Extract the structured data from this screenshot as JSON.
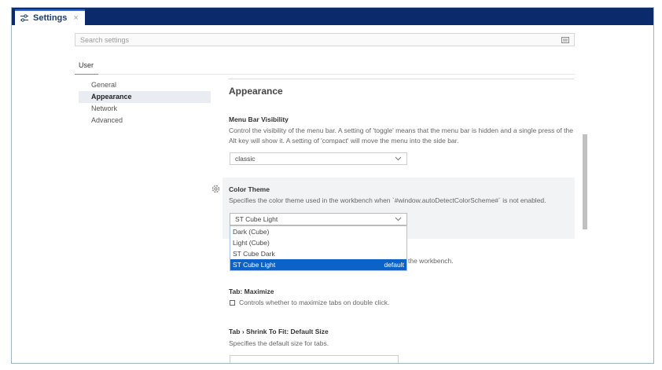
{
  "tab": {
    "title": "Settings",
    "close": "×",
    "icon": "sliders-icon"
  },
  "search": {
    "placeholder": "Search settings",
    "filter_icon": "filter-icon"
  },
  "scope": {
    "user_label": "User"
  },
  "toc": {
    "items": [
      {
        "label": "General"
      },
      {
        "label": "Appearance",
        "active": true
      },
      {
        "label": "Network"
      },
      {
        "label": "Advanced"
      }
    ]
  },
  "section": {
    "title": "Appearance"
  },
  "settings": {
    "menu_bar": {
      "title": "Menu Bar Visibility",
      "description": "Control the visibility of the menu bar. A setting of 'toggle' means that the menu bar is hidden and a single press of the Alt key will show it. A setting of 'compact' will move the menu into the side bar.",
      "value": "classic"
    },
    "color_theme": {
      "title": "Color Theme",
      "description": "Specifies the color theme used in the workbench when `#window.autoDetectColorScheme#` is not enabled.",
      "value": "ST Cube Light",
      "options": [
        {
          "label": "Dark (Cube)",
          "badge": ""
        },
        {
          "label": "Light (Cube)",
          "badge": ""
        },
        {
          "label": "ST Cube Dark",
          "badge": ""
        },
        {
          "label": "ST Cube Light",
          "badge": "default",
          "selected": true
        }
      ]
    },
    "hidden_setting": {
      "description_tail": "the workbench."
    },
    "tab_maximize": {
      "title": "Tab: Maximize",
      "description": "Controls whether to maximize tabs on double click.",
      "checked": false
    },
    "tab_shrink": {
      "title": "Tab › Shrink To Fit: Default Size",
      "description": "Specifies the default size for tabs."
    }
  },
  "colors": {
    "tabbar": "#0a2a6b",
    "selection": "#0b63c9",
    "accent": "#2f6fd6"
  }
}
